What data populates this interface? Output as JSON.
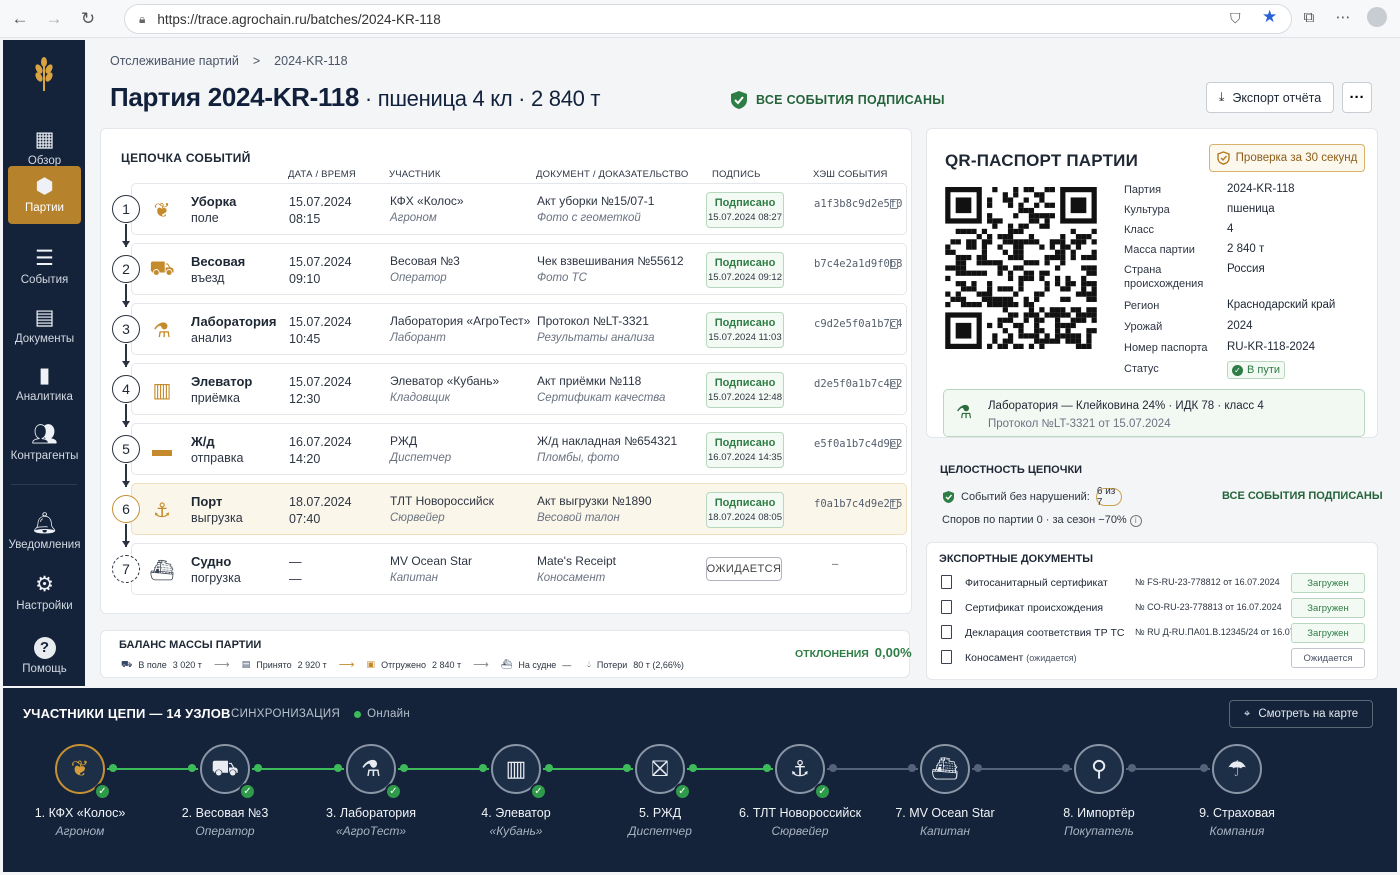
{
  "browser": {
    "url": "https://trace.agrochain.ru/batches/2024-KR-118"
  },
  "sidebar": {
    "items": [
      {
        "label": "Обзор",
        "icon": "grid-icon"
      },
      {
        "label": "Партии",
        "icon": "box-icon",
        "active": true
      },
      {
        "label": "События",
        "icon": "list-icon"
      },
      {
        "label": "Документы",
        "icon": "document-icon"
      },
      {
        "label": "Аналитика",
        "icon": "bar-chart-icon"
      },
      {
        "label": "Контрагенты",
        "icon": "users-icon"
      },
      {
        "label": "Уведомления",
        "icon": "bell-icon"
      },
      {
        "label": "Настройки",
        "icon": "gear-icon"
      },
      {
        "label": "Помощь",
        "icon": "help-icon"
      }
    ]
  },
  "breadcrumb": {
    "parent": "Отслеживание партий",
    "sep": ">",
    "current": "2024-KR-118"
  },
  "header": {
    "title": "Партия 2024-KR-118",
    "subtitle": " · пшеница 4 кл · 2 840 т",
    "signed": "ВСЕ СОБЫТИЯ ПОДПИСАНЫ",
    "export_label": "Экспорт отчёта",
    "more_label": "···"
  },
  "chain": {
    "title": "ЦЕПОЧКА СОБЫТИЙ",
    "columns": {
      "date": "ДАТА / ВРЕМЯ",
      "participant": "УЧАСТНИК",
      "document": "ДОКУМЕНТ / ДОКАЗАТЕЛЬСТВО",
      "signature": "ПОДПИСЬ",
      "hash": "ХЭШ СОБЫТИЯ"
    },
    "rows": [
      {
        "num": "1",
        "name": "Уборка",
        "sub": "поле",
        "date": "15.07.2024",
        "time": "08:15",
        "participant": "КФХ «Колос»",
        "role": "Агроном",
        "doc": "Акт уборки №15/07-1",
        "doc_sub": "Фото с геометкой",
        "sig": "Подписано",
        "sig_time": "15.07.2024 08:27",
        "hash": "a1f3b8c9d2e5f0",
        "icon": "wheat-icon"
      },
      {
        "num": "2",
        "name": "Весовая",
        "sub": "въезд",
        "date": "15.07.2024",
        "time": "09:10",
        "participant": "Весовая №3",
        "role": "Оператор",
        "doc": "Чек взвешивания №55612",
        "doc_sub": "Фото ТС",
        "sig": "Подписано",
        "sig_time": "15.07.2024 09:12",
        "hash": "b7c4e2a1d9f0b8",
        "icon": "truck-icon"
      },
      {
        "num": "3",
        "name": "Лаборатория",
        "sub": "анализ",
        "date": "15.07.2024",
        "time": "10:45",
        "participant": "Лаборатория «АгроТест»",
        "role": "Лаборант",
        "doc": "Протокол №LT-3321",
        "doc_sub": "Результаты анализа",
        "sig": "Подписано",
        "sig_time": "15.07.2024 11:03",
        "hash": "c9d2e5f0a1b7c4",
        "icon": "flask-icon"
      },
      {
        "num": "4",
        "name": "Элеватор",
        "sub": "приёмка",
        "date": "15.07.2024",
        "time": "12:30",
        "participant": "Элеватор «Кубань»",
        "role": "Кладовщик",
        "doc": "Акт приёмки №118",
        "doc_sub": "Сертификат качества",
        "sig": "Подписано",
        "sig_time": "15.07.2024 12:48",
        "hash": "d2e5f0a1b7c4e2",
        "icon": "elevator-icon"
      },
      {
        "num": "5",
        "name": "Ж/д",
        "sub": "отправка",
        "date": "16.07.2024",
        "time": "14:20",
        "participant": "РЖД",
        "role": "Диспетчер",
        "doc": "Ж/д накладная №654321",
        "doc_sub": "Пломбы, фото",
        "sig": "Подписано",
        "sig_time": "16.07.2024 14:35",
        "hash": "e5f0a1b7c4d9e2",
        "icon": "railcar-icon"
      },
      {
        "num": "6",
        "name": "Порт",
        "sub": "выгрузка",
        "date": "18.07.2024",
        "time": "07:40",
        "participant": "ТЛТ Новороссийск",
        "role": "Сюрвейер",
        "doc": "Акт выгрузки №1890",
        "doc_sub": "Весовой талон",
        "sig": "Подписано",
        "sig_time": "18.07.2024 08:05",
        "hash": "f0a1b7c4d9e2f5",
        "icon": "anchor-icon"
      },
      {
        "num": "7",
        "name": "Судно",
        "sub": "погрузка",
        "date": "—",
        "time": "—",
        "participant": "MV Ocean Star",
        "role": "Капитан",
        "doc": "Mate's Receipt",
        "doc_sub": "Коносамент",
        "sig": "ОЖИДАЕТСЯ",
        "sig_time": "",
        "hash": "—",
        "icon": "ship-icon"
      }
    ]
  },
  "balance": {
    "title": "БАЛАНС МАССЫ ПАРТИИ",
    "field_label": "В поле",
    "field_value": "3 020 т",
    "accepted_label": "Принято",
    "accepted_value": "2 920 т",
    "shipped_label": "Отгружено",
    "shipped_value": "2 840 т",
    "ship_label": "На судне",
    "ship_value": "—",
    "loss_label": "Потери",
    "loss_value": "80 т (2,66%)",
    "deviation_label": "ОТКЛОНЕНИЯ",
    "deviation_value": "0,00%"
  },
  "qr": {
    "title": "QR-ПАСПОРТ ПАРТИИ",
    "check_label": "Проверка за 30 секунд",
    "fields": [
      {
        "k": "Партия",
        "v": "2024-KR-118"
      },
      {
        "k": "Культура",
        "v": "пшеница"
      },
      {
        "k": "Класс",
        "v": "4"
      },
      {
        "k": "Масса партии",
        "v": "2 840 т"
      },
      {
        "k": "Страна происхождения",
        "v": "Россия"
      },
      {
        "k": "Регион",
        "v": "Краснодарский край"
      },
      {
        "k": "Урожай",
        "v": "2024"
      },
      {
        "k": "Номер паспорта",
        "v": "RU-KR-118-2024"
      },
      {
        "k": "Статус",
        "v": "В пути"
      }
    ],
    "lab_line1": "Лаборатория — Клейковина 24% · ИДК 78 · класс 4",
    "lab_line2": "Протокол №LT-3321 от 15.07.2024"
  },
  "integrity": {
    "title": "ЦЕЛОСТНОСТЬ ЦЕПОЧКИ",
    "events_label": "Событий без нарушений:",
    "events_value": "6 из 7",
    "right_label": "ВСЕ СОБЫТИЯ ПОДПИСАНЫ",
    "disputes": "Споров по партии  0  · за сезон −70%"
  },
  "export_docs": {
    "title": "ЭКСПОРТНЫЕ ДОКУМЕНТЫ",
    "rows": [
      {
        "name": "Фитосанитарный сертификат",
        "note": "",
        "num": "№ FS-RU-23-778812 от 16.07.2024",
        "status": "Загружен"
      },
      {
        "name": "Сертификат происхождения",
        "note": "",
        "num": "№ CO-RU-23-778813 от 16.07.2024",
        "status": "Загружен"
      },
      {
        "name": "Декларация соответствия ТР ТС",
        "note": "",
        "num": "№ RU Д-RU.ПА01.В.12345/24 от 16.07.2024",
        "status": "Загружен"
      },
      {
        "name": "Коносамент",
        "note": "(ожидается)",
        "num": "",
        "status": "Ожидается"
      }
    ]
  },
  "network": {
    "title": "УЧАСТНИКИ ЦЕПИ  —  14 УЗЛОВ",
    "sync_label": "СИНХРОНИЗАЦИЯ",
    "sync_status": "Онлайн",
    "map_label": "Смотреть на карте",
    "nodes": [
      {
        "name": "1. КФХ «Колос»",
        "role": "Агроном",
        "icon": "wheat-icon",
        "done": true
      },
      {
        "name": "2. Весовая №3",
        "role": "Оператор",
        "icon": "truck-icon",
        "done": true
      },
      {
        "name": "3. Лаборатория",
        "role": "«АгроТест»",
        "icon": "flask-icon",
        "done": true
      },
      {
        "name": "4. Элеватор",
        "role": "«Кубань»",
        "icon": "elevator-icon",
        "done": true
      },
      {
        "name": "5. РЖД",
        "role": "Диспетчер",
        "icon": "train-icon",
        "done": true
      },
      {
        "name": "6. ТЛТ Новороссийск",
        "role": "Сюрвейер",
        "icon": "anchor-icon",
        "done": true
      },
      {
        "name": "7. MV Ocean Star",
        "role": "Капитан",
        "icon": "ship-icon",
        "done": false
      },
      {
        "name": "8. Импортёр",
        "role": "Покупатель",
        "icon": "importer-icon",
        "done": false
      },
      {
        "name": "9. Страховая",
        "role": "Компания",
        "icon": "insurance-icon",
        "done": false
      }
    ]
  },
  "colors": {
    "accent": "#b6822b",
    "navy": "#14233a",
    "green": "#2e7d45"
  }
}
